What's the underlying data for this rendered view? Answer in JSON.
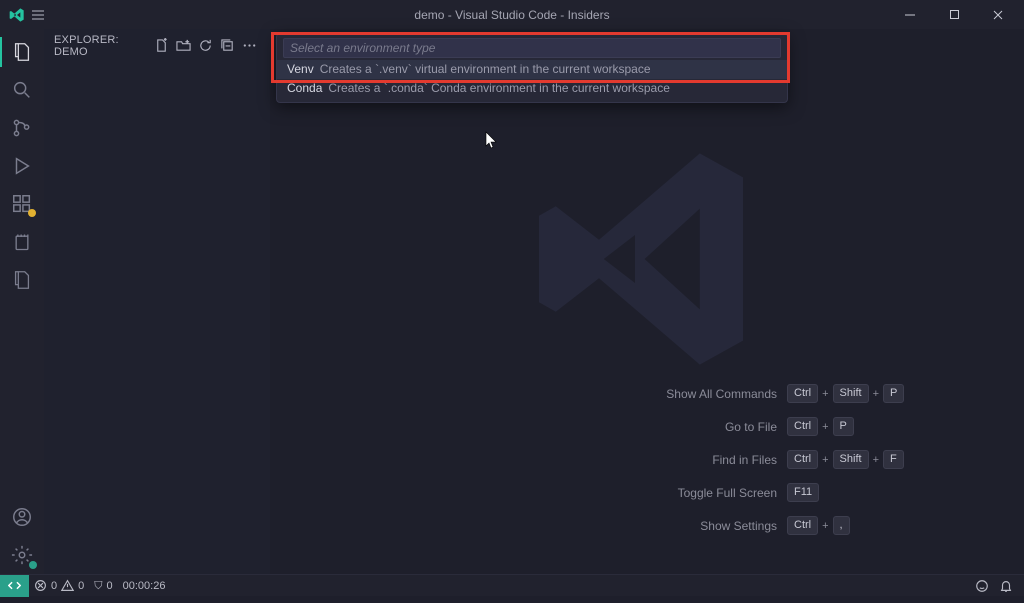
{
  "title": "demo - Visual Studio Code - Insiders",
  "explorer_header": "EXPLORER: DEMO",
  "quickinput": {
    "placeholder": "Select an environment type",
    "items": [
      {
        "name": "Venv",
        "desc": "Creates a `.venv` virtual environment in the current workspace"
      },
      {
        "name": "Conda",
        "desc": "Creates a `.conda` Conda environment in the current workspace"
      }
    ]
  },
  "shortcuts": [
    {
      "label": "Show All Commands",
      "keys": [
        "Ctrl",
        "Shift",
        "P"
      ]
    },
    {
      "label": "Go to File",
      "keys": [
        "Ctrl",
        "P"
      ]
    },
    {
      "label": "Find in Files",
      "keys": [
        "Ctrl",
        "Shift",
        "F"
      ]
    },
    {
      "label": "Toggle Full Screen",
      "keys": [
        "F11"
      ]
    },
    {
      "label": "Show Settings",
      "keys": [
        "Ctrl",
        ","
      ]
    }
  ],
  "status": {
    "errors": "0",
    "warnings": "0",
    "ports_label": "0",
    "time": "00:00:26"
  },
  "icons": {
    "ports_glyph": "⛉"
  }
}
